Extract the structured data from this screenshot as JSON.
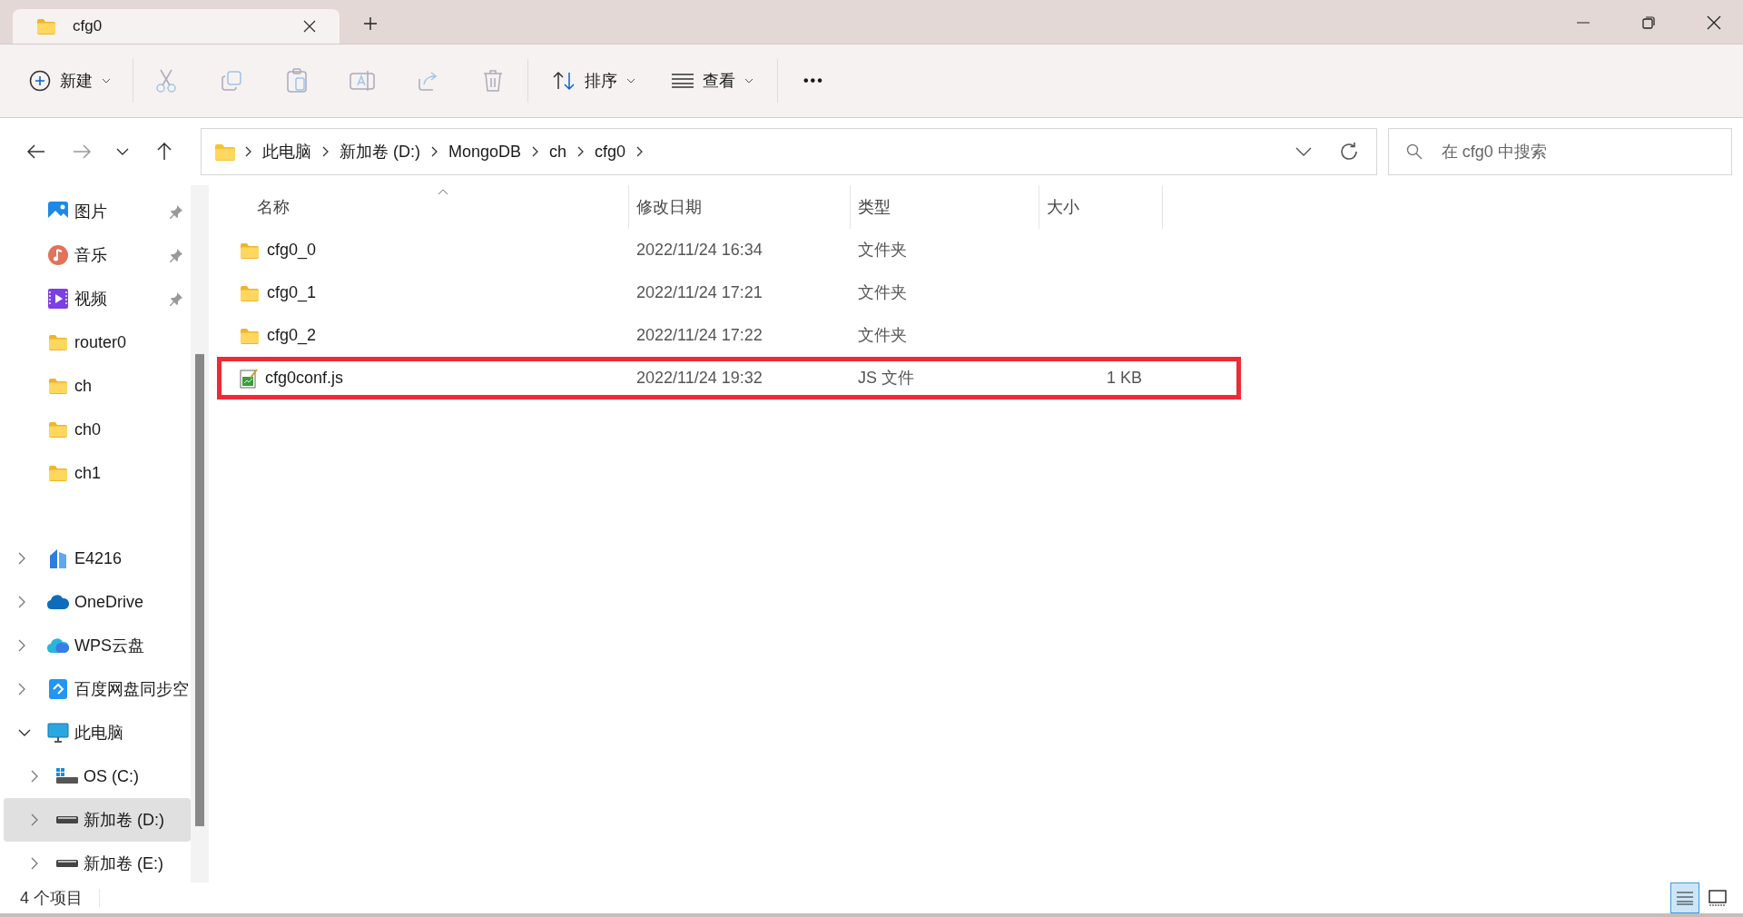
{
  "tabs": [
    {
      "title": "cfg0",
      "selected": true
    }
  ],
  "toolbar": {
    "new": "新建",
    "sort": "排序",
    "view": "查看",
    "more": "•••"
  },
  "address": {
    "crumbs": [
      "此电脑",
      "新加卷 (D:)",
      "MongoDB",
      "ch",
      "cfg0"
    ]
  },
  "search": {
    "placeholder": "在 cfg0 中搜索"
  },
  "sidebar": {
    "items": [
      {
        "label": "图片",
        "kind": "pictures",
        "pinned": true,
        "selected": false
      },
      {
        "label": "音乐",
        "kind": "music",
        "pinned": true,
        "selected": false
      },
      {
        "label": "视频",
        "kind": "videos",
        "pinned": true,
        "selected": false
      },
      {
        "label": "router0",
        "kind": "folder",
        "pinned": false,
        "selected": false
      },
      {
        "label": "ch",
        "kind": "folder",
        "pinned": false,
        "selected": false
      },
      {
        "label": "ch0",
        "kind": "folder",
        "pinned": false,
        "selected": false
      },
      {
        "label": "ch1",
        "kind": "folder",
        "pinned": false,
        "selected": false
      },
      {
        "kind": "divider"
      },
      {
        "label": "E4216",
        "kind": "network",
        "expanded": false,
        "selected": false
      },
      {
        "label": "OneDrive",
        "kind": "onedrive",
        "expanded": false,
        "selected": false
      },
      {
        "label": "WPS云盘",
        "kind": "wps",
        "expanded": false,
        "selected": false
      },
      {
        "label": "百度网盘同步空",
        "kind": "baidu",
        "expanded": false,
        "selected": false
      },
      {
        "label": "此电脑",
        "kind": "pc",
        "expanded": true,
        "selected": false,
        "children": [
          {
            "label": "OS (C:)",
            "kind": "osdrive",
            "expanded": false,
            "selected": false
          },
          {
            "label": "新加卷 (D:)",
            "kind": "drive",
            "expanded": false,
            "selected": true
          },
          {
            "label": "新加卷 (E:)",
            "kind": "drive",
            "expanded": false,
            "selected": false
          }
        ]
      }
    ]
  },
  "table": {
    "columns": [
      "名称",
      "修改日期",
      "类型",
      "大小"
    ],
    "rows": [
      {
        "kind": "folder",
        "name": "cfg0_0",
        "date": "2022/11/24 16:34",
        "type": "文件夹",
        "highlighted": false
      },
      {
        "kind": "folder",
        "name": "cfg0_1",
        "date": "2022/11/24 17:21",
        "type": "文件夹",
        "highlighted": false
      },
      {
        "kind": "folder",
        "name": "cfg0_2",
        "date": "2022/11/24 17:22",
        "type": "文件夹",
        "highlighted": false
      },
      {
        "kind": "script",
        "name": "cfg0conf.js",
        "date": "2022/11/24 19:32",
        "type": "JS 文件",
        "size": "1 KB",
        "highlighted": true
      }
    ]
  },
  "status_bar": {
    "count": "4 个项目"
  }
}
